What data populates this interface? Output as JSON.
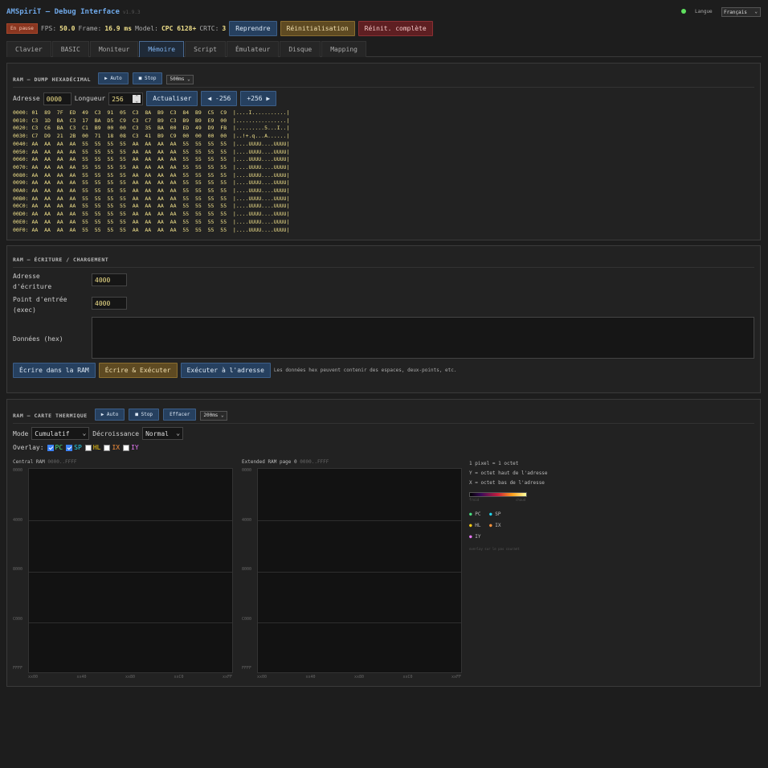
{
  "app": {
    "title": "AMSpiriT — Debug Interface",
    "version": "v1.9.3",
    "lang_label": "Langue",
    "lang_value": "Français"
  },
  "status": {
    "paused_badge": "En pause",
    "fps_label": "FPS:",
    "fps": "50.0",
    "frame_label": "Frame:",
    "frame": "16.9 ms",
    "model_label": "Model:",
    "model": "CPC 6128+",
    "crtc_label": "CRTC:",
    "crtc": "3",
    "resume": "Reprendre",
    "reset": "Réinitialisation",
    "full_reset": "Réinit. complète"
  },
  "tabs": [
    "Clavier",
    "BASIC",
    "Moniteur",
    "Mémoire",
    "Script",
    "Émulateur",
    "Disque",
    "Mapping"
  ],
  "dump": {
    "title": "RAM — DUMP HEXADÉCIMAL",
    "auto": "▶ Auto",
    "stop": "■ Stop",
    "interval": "500ms",
    "addr_label": "Adresse",
    "addr": "0000",
    "len_label": "Longueur",
    "len": "256",
    "refresh": "Actualiser",
    "prev": "◀ -256",
    "next": "+256 ▶",
    "lines": [
      "0000: 01  89  7F  ED  49  C3  91  05  C3  8A  B9  C3  84  B9  C5  C9  |....I...........|",
      "0010: C3  1D  BA  C3  17  BA  D5  C9  C3  C7  B9  C3  B9  B9  E9  00  |................|",
      "0020: C3  C6  BA  C3  C1  B9  00  00  C3  35  BA  00  ED  49  D9  FB  |.........5...I..|",
      "0030: C7  D9  21  2B  00  71  18  08  C3  41  B9  C9  00  00  00  00  |..!+.q...A......|",
      "0040: AA  AA  AA  AA  55  55  55  55  AA  AA  AA  AA  55  55  55  55  |....UUUU....UUUU|",
      "0050: AA  AA  AA  AA  55  55  55  55  AA  AA  AA  AA  55  55  55  55  |....UUUU....UUUU|",
      "0060: AA  AA  AA  AA  55  55  55  55  AA  AA  AA  AA  55  55  55  55  |....UUUU....UUUU|",
      "0070: AA  AA  AA  AA  55  55  55  55  AA  AA  AA  AA  55  55  55  55  |....UUUU....UUUU|",
      "0080: AA  AA  AA  AA  55  55  55  55  AA  AA  AA  AA  55  55  55  55  |....UUUU....UUUU|",
      "0090: AA  AA  AA  AA  55  55  55  55  AA  AA  AA  AA  55  55  55  55  |....UUUU....UUUU|",
      "00A0: AA  AA  AA  AA  55  55  55  55  AA  AA  AA  AA  55  55  55  55  |....UUUU....UUUU|",
      "00B0: AA  AA  AA  AA  55  55  55  55  AA  AA  AA  AA  55  55  55  55  |....UUUU....UUUU|",
      "00C0: AA  AA  AA  AA  55  55  55  55  AA  AA  AA  AA  55  55  55  55  |....UUUU....UUUU|",
      "00D0: AA  AA  AA  AA  55  55  55  55  AA  AA  AA  AA  55  55  55  55  |....UUUU....UUUU|",
      "00E0: AA  AA  AA  AA  55  55  55  55  AA  AA  AA  AA  55  55  55  55  |....UUUU....UUUU|",
      "00F0: AA  AA  AA  AA  55  55  55  55  AA  AA  AA  AA  55  55  55  55  |....UUUU....UUUU|"
    ]
  },
  "write": {
    "title": "RAM — ÉCRITURE / CHARGEMENT",
    "addr_label_1": "Adresse",
    "addr_label_2": "d'écriture",
    "addr": "4000",
    "entry_label_1": "Point d'entrée",
    "entry_label_2": "(exec)",
    "entry": "4000",
    "data_label": "Données (hex)",
    "data": "",
    "write_btn": "Écrire dans la RAM",
    "write_exec_btn": "Écrire & Exécuter",
    "exec_btn": "Exécuter à l'adresse",
    "note": "Les données hex peuvent contenir des espaces, deux-points, etc."
  },
  "heatmap": {
    "title": "RAM — CARTE THERMIQUE",
    "auto": "▶ Auto",
    "stop": "■ Stop",
    "clear": "Effacer",
    "interval": "200ms",
    "mode_label": "Mode",
    "mode": "Cumulatif",
    "decay_label": "Décroissance",
    "decay": "Normal",
    "overlay_label": "Overlay:",
    "overlays": [
      {
        "name": "PC",
        "checked": true,
        "color": "#4ade80"
      },
      {
        "name": "SP",
        "checked": true,
        "color": "#22d3ee"
      },
      {
        "name": "HL",
        "checked": false,
        "color": "#facc15"
      },
      {
        "name": "IX",
        "checked": false,
        "color": "#fb923c"
      },
      {
        "name": "IY",
        "checked": false,
        "color": "#e879f9"
      }
    ],
    "maps": [
      {
        "title": "Central RAM",
        "range": "0000..FFFF"
      },
      {
        "title": "Extended RAM page 0",
        "range": "0000..FFFF"
      }
    ],
    "y_ticks": [
      "0000",
      "4000",
      "8000",
      "C000",
      "FFFF"
    ],
    "x_ticks": [
      "xx00",
      "xx40",
      "xx80",
      "xxC0",
      "xxFF"
    ],
    "legend": {
      "line1": "1 pixel = 1 octet",
      "line2": "Y = octet haut de l'adresse",
      "line3": "X = octet bas de l'adresse",
      "grad_min": "froid",
      "grad_max": "chaud",
      "footer": "overlay sur le pas courant"
    }
  }
}
